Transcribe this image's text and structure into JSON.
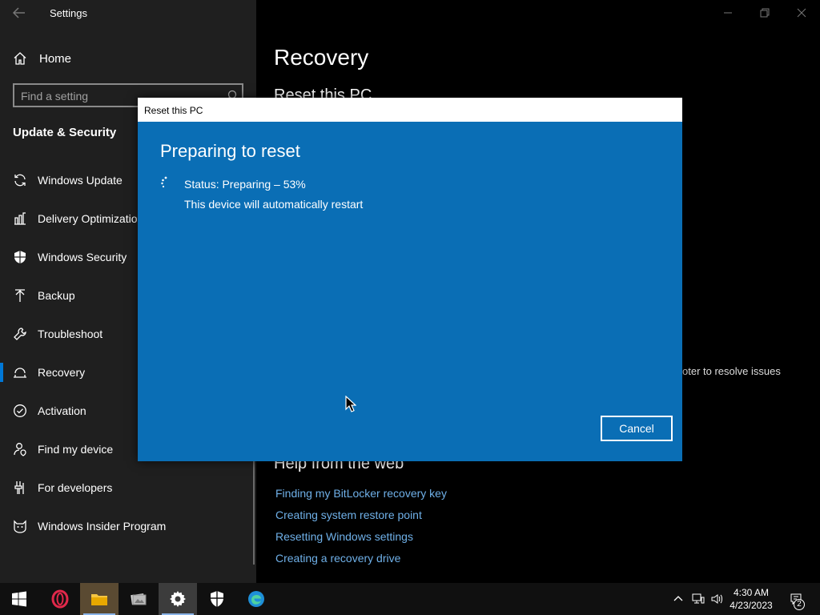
{
  "window": {
    "title": "Settings"
  },
  "sidebar": {
    "home_label": "Home",
    "search_placeholder": "Find a setting",
    "section_heading": "Update & Security",
    "items": [
      {
        "label": "Windows Update",
        "icon": "sync-icon"
      },
      {
        "label": "Delivery Optimization",
        "icon": "delivery-optimization-icon"
      },
      {
        "label": "Windows Security",
        "icon": "shield-icon"
      },
      {
        "label": "Backup",
        "icon": "backup-arrow-icon"
      },
      {
        "label": "Troubleshoot",
        "icon": "wrench-icon"
      },
      {
        "label": "Recovery",
        "icon": "recovery-icon",
        "active": true
      },
      {
        "label": "Activation",
        "icon": "check-circle-icon"
      },
      {
        "label": "Find my device",
        "icon": "person-location-icon"
      },
      {
        "label": "For developers",
        "icon": "developer-icon"
      },
      {
        "label": "Windows Insider Program",
        "icon": "insider-cat-icon"
      }
    ]
  },
  "content": {
    "page_title": "Recovery",
    "subtitle": "Reset this PC",
    "partial_text": "oter to resolve issues",
    "help_heading": "Help from the web",
    "help_links": [
      "Finding my BitLocker recovery key",
      "Creating system restore point",
      "Resetting Windows settings",
      "Creating a recovery drive"
    ]
  },
  "dialog": {
    "title": "Reset this PC",
    "heading": "Preparing to reset",
    "status": "Status: Preparing – 53%",
    "progress_percent": 53,
    "note": "This device will automatically restart",
    "cancel_label": "Cancel"
  },
  "taskbar": {
    "apps": [
      "start-icon",
      "opera-icon",
      "file-explorer-icon",
      "photos-icon",
      "settings-gear-icon",
      "windows-security-icon",
      "edge-icon"
    ],
    "time": "4:30 AM",
    "date": "4/23/2023",
    "notification_count": "2"
  },
  "colors": {
    "accent": "#0078d7",
    "dialog_bg": "#0a6eb5",
    "sidebar_bg": "#1f1f1f",
    "link": "#6fb0e8"
  }
}
